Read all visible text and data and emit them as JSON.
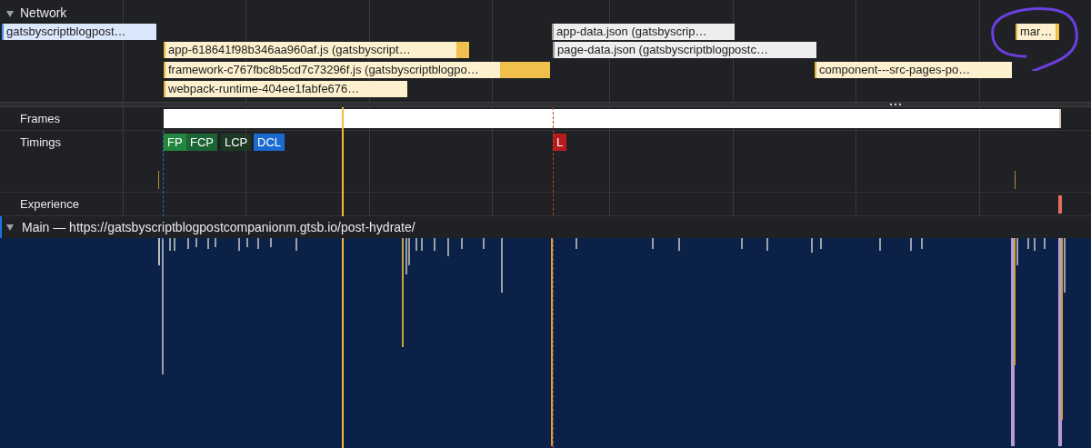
{
  "network": {
    "title": "Network",
    "expanded": true,
    "requests": [
      {
        "label": "gatsbyscriptblogpost…",
        "kind": "document"
      },
      {
        "label": "app-data.json (gatsbyscrip…",
        "kind": "data"
      },
      {
        "label": "mar…",
        "kind": "script"
      },
      {
        "label": "app-618641f98b346aa960af.js (gatsbyscript…",
        "kind": "script"
      },
      {
        "label": "page-data.json (gatsbyscriptblogpostc…",
        "kind": "data"
      },
      {
        "label": "framework-c767fbc8b5cd7c73296f.js (gatsbyscriptblogpo…",
        "kind": "script"
      },
      {
        "label": "component---src-pages-po…",
        "kind": "script"
      },
      {
        "label": "webpack-runtime-404ee1fabfe676…",
        "kind": "script"
      }
    ]
  },
  "tracks": {
    "frames": {
      "label": "Frames"
    },
    "timings": {
      "label": "Timings",
      "markers": [
        {
          "label": "FP",
          "color": "#23863e"
        },
        {
          "label": "FCP",
          "color": "#1b6434"
        },
        {
          "label": "LCP",
          "color": "#1d3825"
        },
        {
          "label": "DCL",
          "color": "#1a6ad0"
        },
        {
          "label": "L",
          "color": "#b71c1c"
        }
      ]
    },
    "experience": {
      "label": "Experience"
    }
  },
  "main": {
    "title": "Main — https://gatsbyscriptblogpostcompanionm.gtsb.io/post-hydrate/",
    "expanded": true
  }
}
